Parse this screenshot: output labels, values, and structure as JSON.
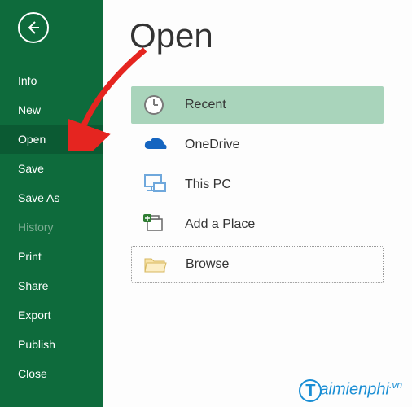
{
  "sidebar": {
    "items": [
      {
        "label": "Info",
        "active": false,
        "dim": false
      },
      {
        "label": "New",
        "active": false,
        "dim": false
      },
      {
        "label": "Open",
        "active": true,
        "dim": false
      },
      {
        "label": "Save",
        "active": false,
        "dim": false
      },
      {
        "label": "Save As",
        "active": false,
        "dim": false
      },
      {
        "label": "History",
        "active": false,
        "dim": true
      },
      {
        "label": "Print",
        "active": false,
        "dim": false
      },
      {
        "label": "Share",
        "active": false,
        "dim": false
      },
      {
        "label": "Export",
        "active": false,
        "dim": false
      },
      {
        "label": "Publish",
        "active": false,
        "dim": false
      },
      {
        "label": "Close",
        "active": false,
        "dim": false
      }
    ]
  },
  "page": {
    "title": "Open"
  },
  "open": {
    "items": [
      {
        "label": "Recent",
        "kind": "recent",
        "icon": "clock"
      },
      {
        "label": "OneDrive",
        "kind": "normal",
        "icon": "onedrive"
      },
      {
        "label": "This PC",
        "kind": "normal",
        "icon": "pc"
      },
      {
        "label": "Add a Place",
        "kind": "normal",
        "icon": "addplace"
      },
      {
        "label": "Browse",
        "kind": "browse",
        "icon": "folder"
      }
    ]
  },
  "colors": {
    "brand": "#0e6b3c",
    "accent": "#a9d4bb",
    "arrow": "#e52520",
    "watermark": "#1a8ed4"
  },
  "watermark": {
    "text": "aimienphi",
    "suffix": ".vn"
  }
}
